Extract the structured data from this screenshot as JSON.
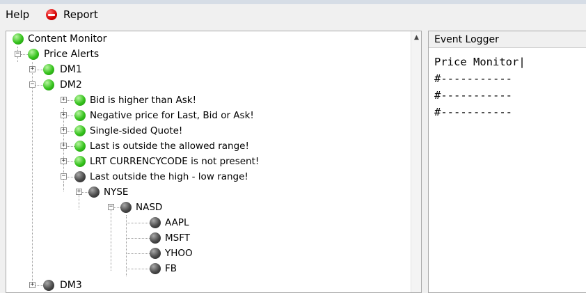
{
  "menubar": {
    "help_label": "Help",
    "report_label": "Report",
    "report_icon": "no-entry-icon",
    "report_icon_color": "#d40000"
  },
  "tree": {
    "root": "Content Monitor",
    "price_alerts": "Price Alerts",
    "dm1": "DM1",
    "dm2": "DM2",
    "alerts": [
      "Bid is higher than Ask!",
      "Negative price for Last, Bid or Ask!",
      "Single-sided Quote!",
      "Last is outside the allowed range!",
      "LRT CURRENCYCODE is not present!",
      "Last outside the high - low range!"
    ],
    "exchanges": [
      "NYSE",
      "NASD"
    ],
    "symbols": [
      "AAPL",
      "MSFT",
      "YHOO",
      "FB"
    ],
    "dm3": "DM3",
    "status_colors": {
      "ok": "#35c21c",
      "alert": "#4a4a4a"
    }
  },
  "logger": {
    "title": "Event Logger",
    "lines": [
      "Price Monitor|",
      "#-----------",
      "#-----------",
      "#-----------"
    ]
  }
}
